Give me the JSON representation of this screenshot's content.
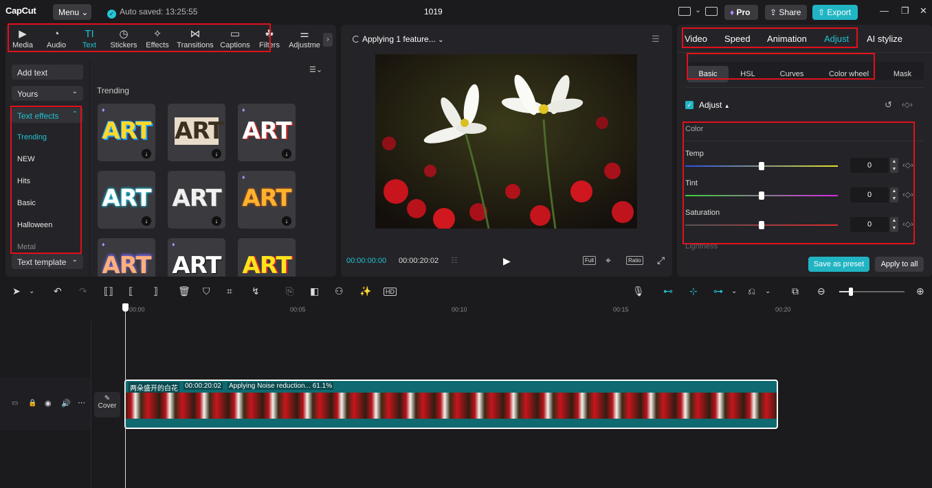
{
  "titlebar": {
    "logo": "CapCut",
    "menu": "Menu",
    "autosaved": "Auto saved: 13:25:55",
    "project_name": "1019",
    "pro": "Pro",
    "share": "Share",
    "export": "Export"
  },
  "media_tabs": [
    {
      "label": "Media",
      "icon": "media-icon"
    },
    {
      "label": "Audio",
      "icon": "audio-icon"
    },
    {
      "label": "Text",
      "icon": "text-icon"
    },
    {
      "label": "Stickers",
      "icon": "stickers-icon"
    },
    {
      "label": "Effects",
      "icon": "effects-icon"
    },
    {
      "label": "Transitions",
      "icon": "transitions-icon"
    },
    {
      "label": "Captions",
      "icon": "captions-icon"
    },
    {
      "label": "Filters",
      "icon": "filters-icon"
    },
    {
      "label": "Adjustme",
      "icon": "adjustment-icon"
    }
  ],
  "text_sidebar": {
    "add_text": "Add text",
    "yours": "Yours",
    "text_effects": "Text effects",
    "items": [
      "Trending",
      "NEW",
      "Hits",
      "Basic",
      "Halloween",
      "Metal"
    ],
    "text_template": "Text template"
  },
  "library": {
    "section_title": "Trending",
    "tile_text": "ART"
  },
  "preview": {
    "status": "Applying 1 feature...",
    "current_time": "00:00:00:00",
    "duration": "00:00:20:02",
    "full": "Full",
    "ratio": "Ratio"
  },
  "inspector": {
    "tabs": [
      "Video",
      "Speed",
      "Animation",
      "Adjust",
      "AI stylize"
    ],
    "subtabs": [
      "Basic",
      "HSL",
      "Curves",
      "Color wheel",
      "Mask"
    ],
    "adjust_label": "Adjust",
    "color_section": "Color",
    "sliders": [
      {
        "label": "Temp",
        "value": "0"
      },
      {
        "label": "Tint",
        "value": "0"
      },
      {
        "label": "Saturation",
        "value": "0"
      }
    ],
    "next_section": "Lightness",
    "save_preset": "Save as preset",
    "apply_all": "Apply to all"
  },
  "timeline": {
    "ticks": [
      "00:00",
      "00:05",
      "00:10",
      "00:15",
      "00:20"
    ],
    "clip_name": "两朵盛开的白花",
    "clip_duration": "00:00:20:02",
    "clip_status": "Applying Noise reduction... 61.1%",
    "cover": "Cover"
  },
  "colors": {
    "accent": "#21c3d3",
    "highlight_box": "#e3101b",
    "clip_bg": "#0e6a70"
  }
}
